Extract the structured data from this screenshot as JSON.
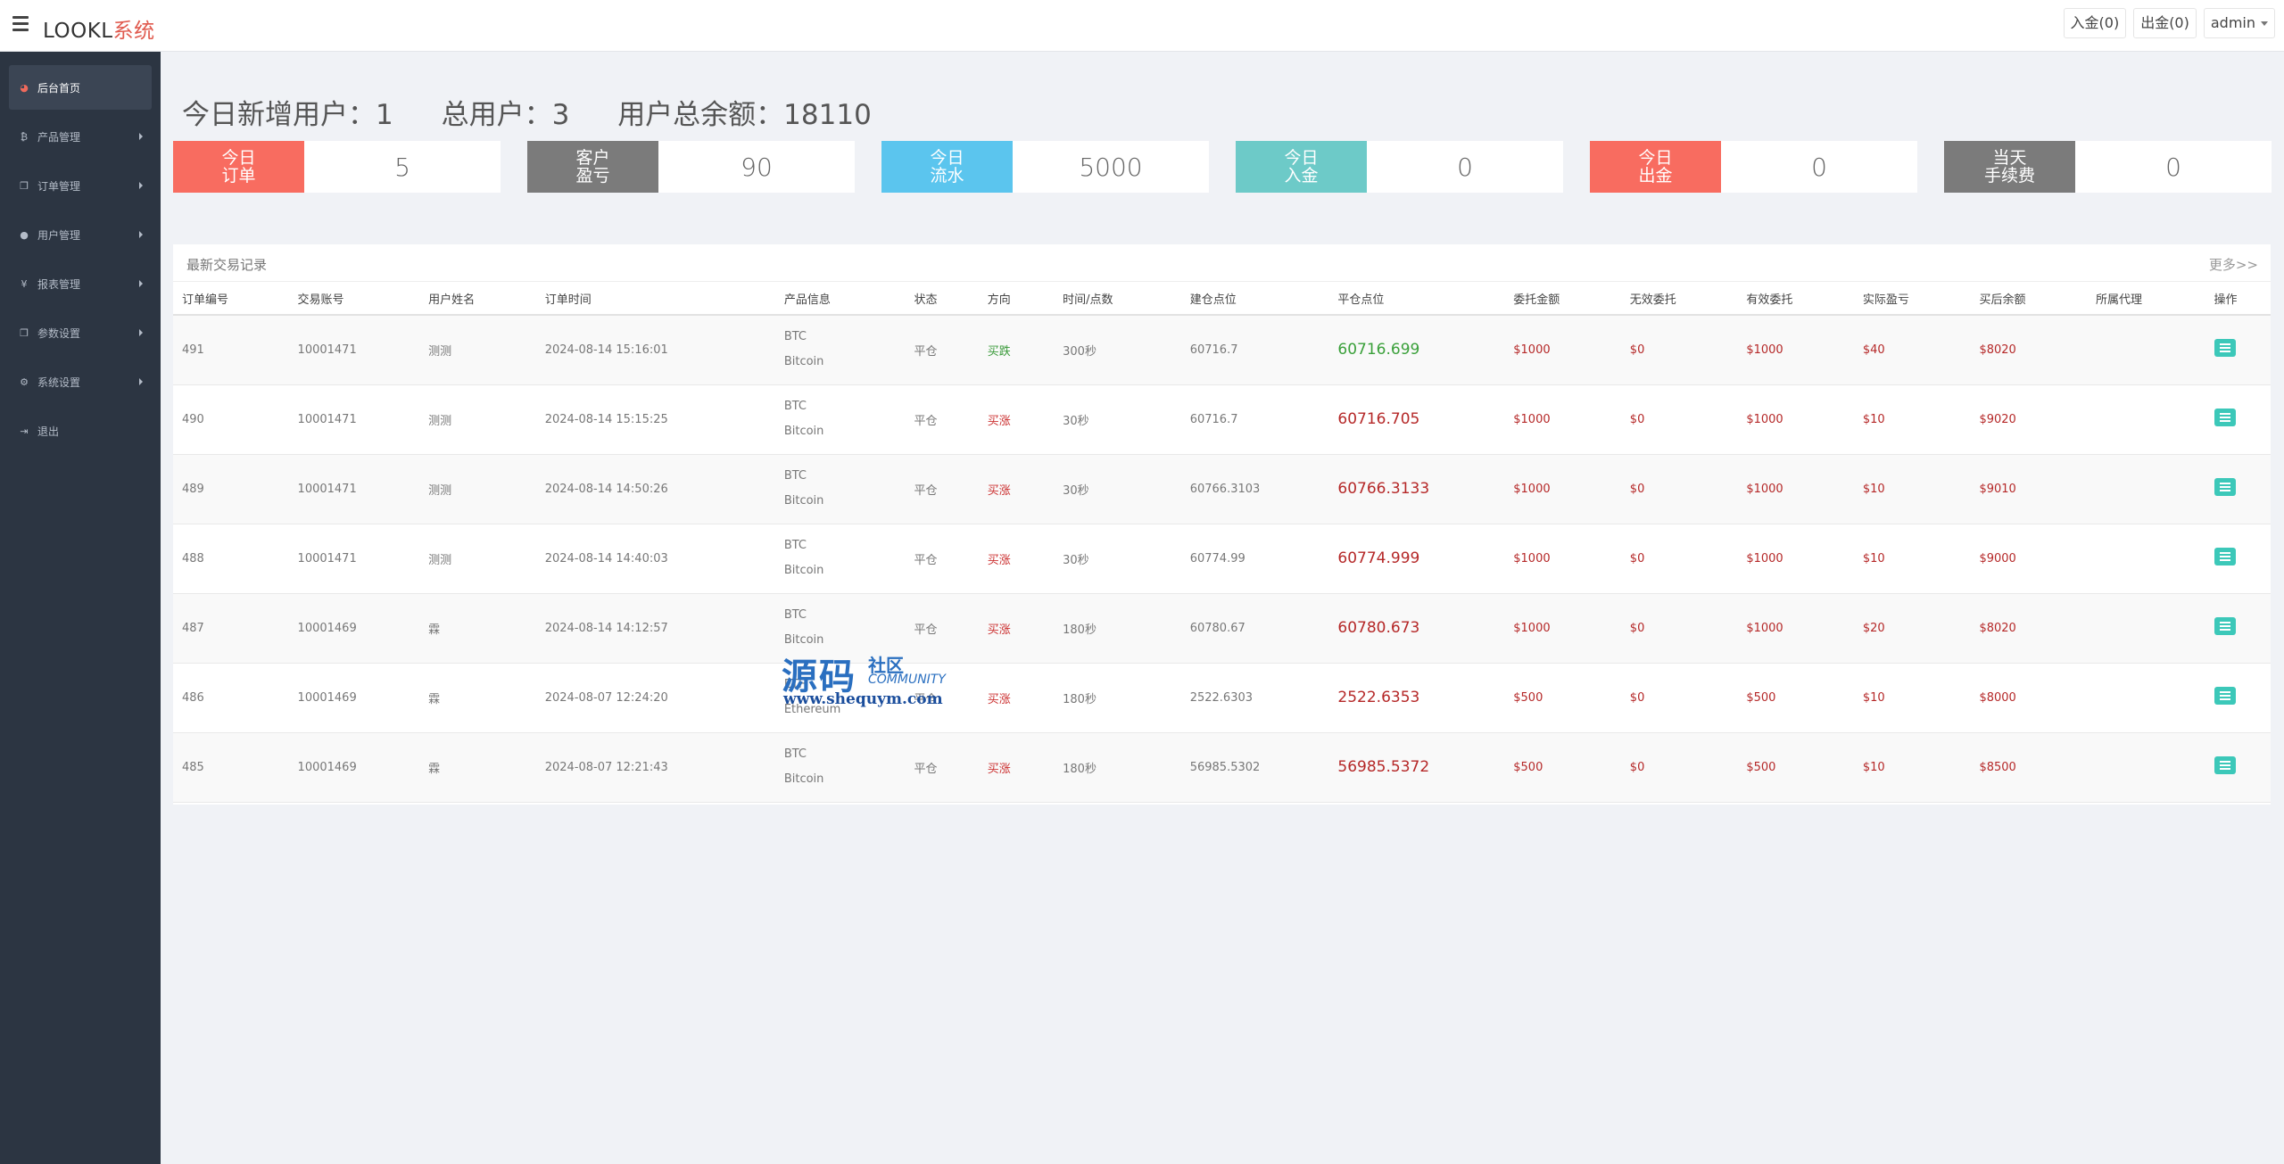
{
  "header": {
    "brand_main": "LOOKL",
    "brand_accent": "系统",
    "deposit_btn": "入金(0)",
    "withdraw_btn": "出金(0)",
    "user": "admin"
  },
  "sidebar": {
    "items": [
      {
        "label": "后台首页",
        "icon": "dashboard-icon",
        "glyph": "◕"
      },
      {
        "label": "产品管理",
        "icon": "bitcoin-icon",
        "glyph": "₿"
      },
      {
        "label": "订单管理",
        "icon": "copy-icon",
        "glyph": "❐"
      },
      {
        "label": "用户管理",
        "icon": "user-icon",
        "glyph": "●"
      },
      {
        "label": "报表管理",
        "icon": "yen-icon",
        "glyph": "¥"
      },
      {
        "label": "参数设置",
        "icon": "copy-icon",
        "glyph": "❐"
      },
      {
        "label": "系统设置",
        "icon": "gears-icon",
        "glyph": "⚙"
      },
      {
        "label": "退出",
        "icon": "sign-out-icon",
        "glyph": "⇥"
      }
    ]
  },
  "summary": {
    "new_users": "今日新增用户：1",
    "total_users": "总用户：3",
    "total_balance": "用户总余额：18110"
  },
  "stats": [
    {
      "label": "今日\n订单",
      "value": "5",
      "color": "#f86c60"
    },
    {
      "label": "客户\n盈亏",
      "value": "90",
      "color": "#7b7b7b"
    },
    {
      "label": "今日\n流水",
      "value": "5000",
      "color": "#5bc5ee"
    },
    {
      "label": "今日\n入金",
      "value": "0",
      "color": "#6dcac8"
    },
    {
      "label": "今日\n出金",
      "value": "0",
      "color": "#f86c60"
    },
    {
      "label": "当天\n手续费",
      "value": "0",
      "color": "#7b7b7b"
    }
  ],
  "panel": {
    "title": "最新交易记录",
    "more": "更多>>"
  },
  "table": {
    "headers": [
      "订单编号",
      "交易账号",
      "用户姓名",
      "订单时间",
      "产品信息",
      "状态",
      "方向",
      "时间/点数",
      "建仓点位",
      "平仓点位",
      "委托金额",
      "无效委托",
      "有效委托",
      "实际盈亏",
      "买后余额",
      "所属代理",
      "操作"
    ],
    "rows": [
      {
        "id": "491",
        "account": "10001471",
        "name": "测测",
        "time": "2024-08-14 15:16:01",
        "sym": "BTC",
        "product": "Bitcoin",
        "status": "平仓",
        "direction": "买跌",
        "dir": "fall",
        "duration": "300秒",
        "open": "60716.7",
        "close": "60716.699",
        "close_up": false,
        "amount": "$1000",
        "invalid": "$0",
        "valid": "$1000",
        "pnl": "$40",
        "balance": "$8020",
        "agent": ""
      },
      {
        "id": "490",
        "account": "10001471",
        "name": "测测",
        "time": "2024-08-14 15:15:25",
        "sym": "BTC",
        "product": "Bitcoin",
        "status": "平仓",
        "direction": "买涨",
        "dir": "rise",
        "duration": "30秒",
        "open": "60716.7",
        "close": "60716.705",
        "close_up": true,
        "amount": "$1000",
        "invalid": "$0",
        "valid": "$1000",
        "pnl": "$10",
        "balance": "$9020",
        "agent": ""
      },
      {
        "id": "489",
        "account": "10001471",
        "name": "测测",
        "time": "2024-08-14 14:50:26",
        "sym": "BTC",
        "product": "Bitcoin",
        "status": "平仓",
        "direction": "买涨",
        "dir": "rise",
        "duration": "30秒",
        "open": "60766.3103",
        "close": "60766.3133",
        "close_up": true,
        "amount": "$1000",
        "invalid": "$0",
        "valid": "$1000",
        "pnl": "$10",
        "balance": "$9010",
        "agent": ""
      },
      {
        "id": "488",
        "account": "10001471",
        "name": "测测",
        "time": "2024-08-14 14:40:03",
        "sym": "BTC",
        "product": "Bitcoin",
        "status": "平仓",
        "direction": "买涨",
        "dir": "rise",
        "duration": "30秒",
        "open": "60774.99",
        "close": "60774.999",
        "close_up": true,
        "amount": "$1000",
        "invalid": "$0",
        "valid": "$1000",
        "pnl": "$10",
        "balance": "$9000",
        "agent": ""
      },
      {
        "id": "487",
        "account": "10001469",
        "name": "霖",
        "time": "2024-08-14 14:12:57",
        "sym": "BTC",
        "product": "Bitcoin",
        "status": "平仓",
        "direction": "买涨",
        "dir": "rise",
        "duration": "180秒",
        "open": "60780.67",
        "close": "60780.673",
        "close_up": true,
        "amount": "$1000",
        "invalid": "$0",
        "valid": "$1000",
        "pnl": "$20",
        "balance": "$8020",
        "agent": ""
      },
      {
        "id": "486",
        "account": "10001469",
        "name": "霖",
        "time": "2024-08-07 12:24:20",
        "sym": "ETH",
        "product": "Ethereum",
        "status": "平仓",
        "direction": "买涨",
        "dir": "rise",
        "duration": "180秒",
        "open": "2522.6303",
        "close": "2522.6353",
        "close_up": true,
        "amount": "$500",
        "invalid": "$0",
        "valid": "$500",
        "pnl": "$10",
        "balance": "$8000",
        "agent": ""
      },
      {
        "id": "485",
        "account": "10001469",
        "name": "霖",
        "time": "2024-08-07 12:21:43",
        "sym": "BTC",
        "product": "Bitcoin",
        "status": "平仓",
        "direction": "买涨",
        "dir": "rise",
        "duration": "180秒",
        "open": "56985.5302",
        "close": "56985.5372",
        "close_up": true,
        "amount": "$500",
        "invalid": "$0",
        "valid": "$500",
        "pnl": "$10",
        "balance": "$8500",
        "agent": ""
      }
    ]
  },
  "watermark": {
    "big": "源码",
    "small": "社区",
    "community": "COMMUNITY",
    "url": "www.shequym.com"
  }
}
